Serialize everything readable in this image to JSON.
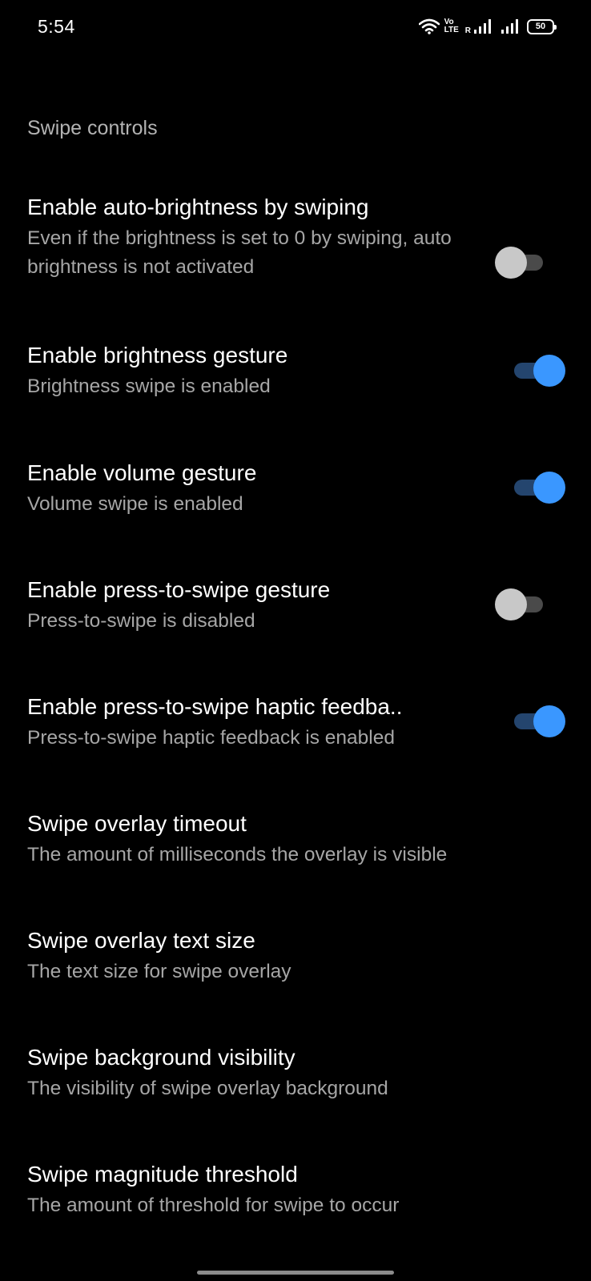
{
  "status_bar": {
    "time": "5:54",
    "volte_top": "Vo",
    "volte_bottom": "LTE",
    "roaming": "R",
    "battery": "50"
  },
  "section": {
    "title": "Swipe controls"
  },
  "items": [
    {
      "title": "Enable auto-brightness by swiping",
      "summary": "Even if the brightness is set to 0 by swiping, auto brightness is not activated",
      "switch": "off"
    },
    {
      "title": "Enable brightness gesture",
      "summary": "Brightness swipe is enabled",
      "switch": "on"
    },
    {
      "title": "Enable volume gesture",
      "summary": "Volume swipe is enabled",
      "switch": "on"
    },
    {
      "title": "Enable press-to-swipe gesture",
      "summary": "Press-to-swipe is disabled",
      "switch": "off"
    },
    {
      "title": "Enable press-to-swipe haptic feedba..",
      "summary": "Press-to-swipe haptic feedback is enabled",
      "switch": "on"
    },
    {
      "title": "Swipe overlay timeout",
      "summary": "The amount of milliseconds the overlay is visible"
    },
    {
      "title": "Swipe overlay text size",
      "summary": "The text size for swipe overlay"
    },
    {
      "title": "Swipe background visibility",
      "summary": "The visibility of swipe overlay background"
    },
    {
      "title": "Swipe magnitude threshold",
      "summary": "The amount of threshold for swipe to occur"
    }
  ],
  "colors": {
    "background": "#000000",
    "accent": "#3a97ff",
    "summary_text": "#a6a6a6"
  }
}
